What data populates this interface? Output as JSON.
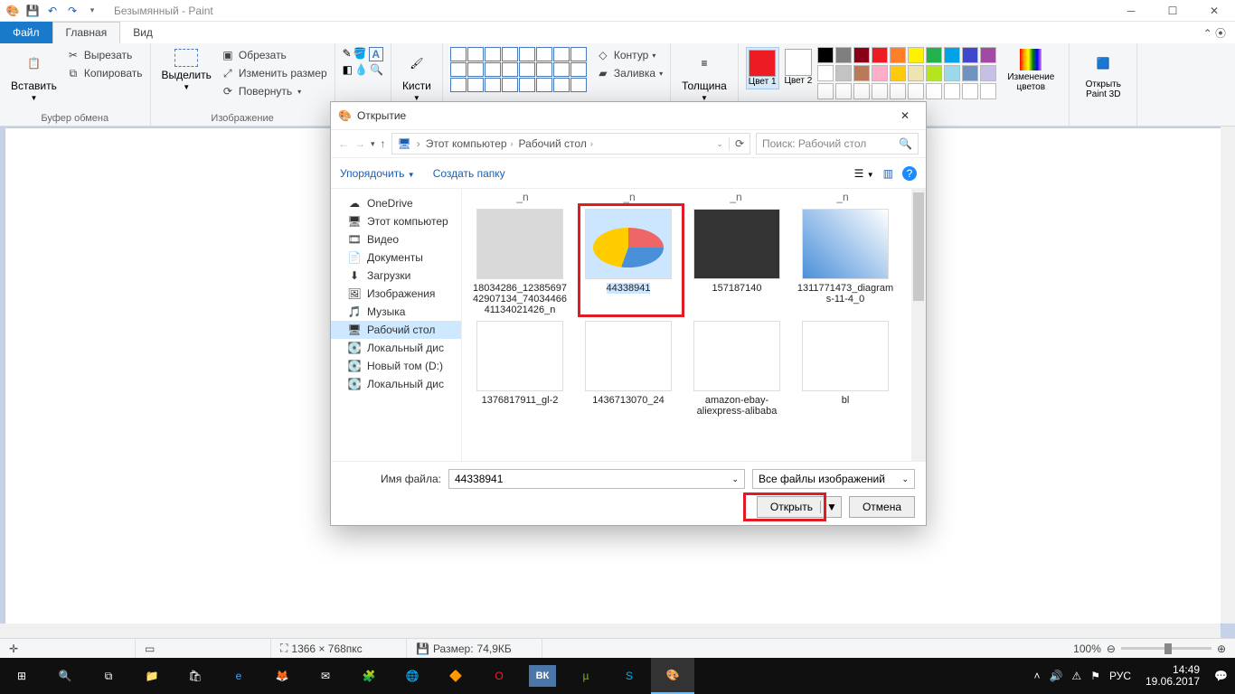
{
  "window": {
    "title": "Безымянный - Paint"
  },
  "tabs": {
    "file": "Файл",
    "home": "Главная",
    "view": "Вид"
  },
  "ribbon": {
    "paste": "Вставить",
    "cut": "Вырезать",
    "copy": "Копировать",
    "clipboard": "Буфер обмена",
    "select": "Выделить",
    "crop": "Обрезать",
    "resize": "Изменить размер",
    "rotate": "Повернуть",
    "image": "Изображение",
    "brushes": "Кисти",
    "outline": "Контур",
    "fill": "Заливка",
    "thickness": "Толщина",
    "color1": "Цвет 1",
    "color2": "Цвет 2",
    "edit_colors": "Изменение цветов",
    "open_3d": "Открыть Paint 3D"
  },
  "palette": [
    "#000",
    "#7f7f7f",
    "#880015",
    "#ed1c24",
    "#ff7f27",
    "#fff200",
    "#22b14c",
    "#00a2e8",
    "#3f48cc",
    "#a349a4",
    "#fff",
    "#c3c3c3",
    "#b97a57",
    "#ffaec9",
    "#ffc90e",
    "#efe4b0",
    "#b5e61d",
    "#99d9ea",
    "#7092be",
    "#c8bfe7"
  ],
  "dialog": {
    "title": "Открытие",
    "breadcrumb": [
      "Этот компьютер",
      "Рабочий стол"
    ],
    "search_placeholder": "Поиск: Рабочий стол",
    "organize": "Упорядочить",
    "new_folder": "Создать папку",
    "tree": [
      {
        "icon": "cloud",
        "label": "OneDrive"
      },
      {
        "icon": "pc",
        "label": "Этот компьютер"
      },
      {
        "icon": "video",
        "label": "Видео"
      },
      {
        "icon": "doc",
        "label": "Документы"
      },
      {
        "icon": "down",
        "label": "Загрузки"
      },
      {
        "icon": "img",
        "label": "Изображения"
      },
      {
        "icon": "music",
        "label": "Музыка"
      },
      {
        "icon": "desktop",
        "label": "Рабочий стол",
        "selected": true
      },
      {
        "icon": "disk",
        "label": "Локальный дис"
      },
      {
        "icon": "disk",
        "label": "Новый том (D:)"
      },
      {
        "icon": "disk",
        "label": "Локальный дис"
      }
    ],
    "header_row": [
      "_n",
      "_n",
      "_n",
      "_n"
    ],
    "files": [
      {
        "name": "18034286_1238569742907134_7403446641134021426_n"
      },
      {
        "name": "44338941",
        "selected": true
      },
      {
        "name": "157187140"
      },
      {
        "name": "1311771473_diagrams-11-4_0"
      },
      {
        "name": "1376817911_gl-2"
      },
      {
        "name": "1436713070_24"
      },
      {
        "name": "amazon-ebay-aliexpress-alibaba"
      },
      {
        "name": "bl"
      }
    ],
    "filename_label": "Имя файла:",
    "filename_value": "44338941",
    "filter": "Все файлы изображений",
    "open_btn": "Открыть",
    "cancel_btn": "Отмена"
  },
  "status": {
    "dimensions": "1366 × 768пкс",
    "size_label": "Размер:",
    "size_value": "74,9КБ",
    "zoom": "100%"
  },
  "taskbar": {
    "lang": "РУС",
    "time": "14:49",
    "date": "19.06.2017"
  }
}
